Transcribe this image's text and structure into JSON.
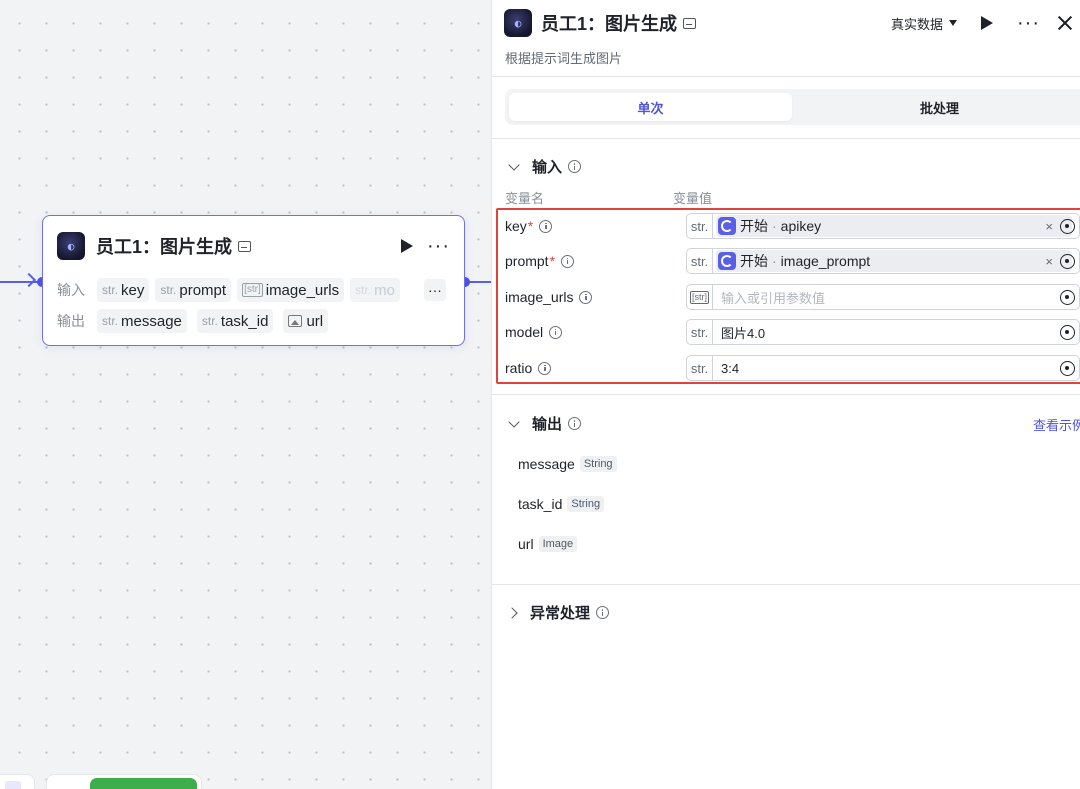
{
  "node": {
    "title": "员工1：图片生成",
    "input_label": "输入",
    "output_label": "输出",
    "inputs": [
      {
        "type": "str.",
        "name": "key"
      },
      {
        "type": "str.",
        "name": "prompt"
      },
      {
        "type": "[str]",
        "name": "image_urls"
      },
      {
        "type": "str.",
        "name": "mo"
      }
    ],
    "outputs": [
      {
        "type": "str.",
        "name": "message"
      },
      {
        "type": "str.",
        "name": "task_id"
      },
      {
        "type": "image",
        "name": "url"
      }
    ],
    "more_label": "···"
  },
  "panel": {
    "title": "员工1：图片生成",
    "description": "根据提示词生成图片",
    "mode_select": "真实数据",
    "tabs": [
      {
        "label": "单次",
        "active": true
      },
      {
        "label": "批处理",
        "active": false
      }
    ],
    "input_section": {
      "title": "输入",
      "col_name": "变量名",
      "col_value": "变量值",
      "rows": [
        {
          "name": "key",
          "required": true,
          "type": "str.",
          "kind": "ref",
          "ref_node": "开始",
          "ref_var": "apikey"
        },
        {
          "name": "prompt",
          "required": true,
          "type": "str.",
          "kind": "ref",
          "ref_node": "开始",
          "ref_var": "image_prompt"
        },
        {
          "name": "image_urls",
          "required": false,
          "type": "[str]",
          "kind": "placeholder",
          "placeholder": "输入或引用参数值"
        },
        {
          "name": "model",
          "required": false,
          "type": "str.",
          "kind": "value",
          "value": "图片4.0"
        },
        {
          "name": "ratio",
          "required": false,
          "type": "str.",
          "kind": "value",
          "value": "3:4"
        }
      ],
      "required_mark": "*",
      "clear_glyph": "×",
      "ref_separator": "·"
    },
    "output_section": {
      "title": "输出",
      "see_example": "查看示例",
      "rows": [
        {
          "name": "message",
          "type": "String"
        },
        {
          "name": "task_id",
          "type": "String"
        },
        {
          "name": "url",
          "type": "Image"
        }
      ]
    },
    "exception_section": {
      "title": "异常处理"
    }
  },
  "colors": {
    "accent": "#4e53e0",
    "highlight_border": "#e0433b",
    "run_button": "#3dae4b"
  }
}
